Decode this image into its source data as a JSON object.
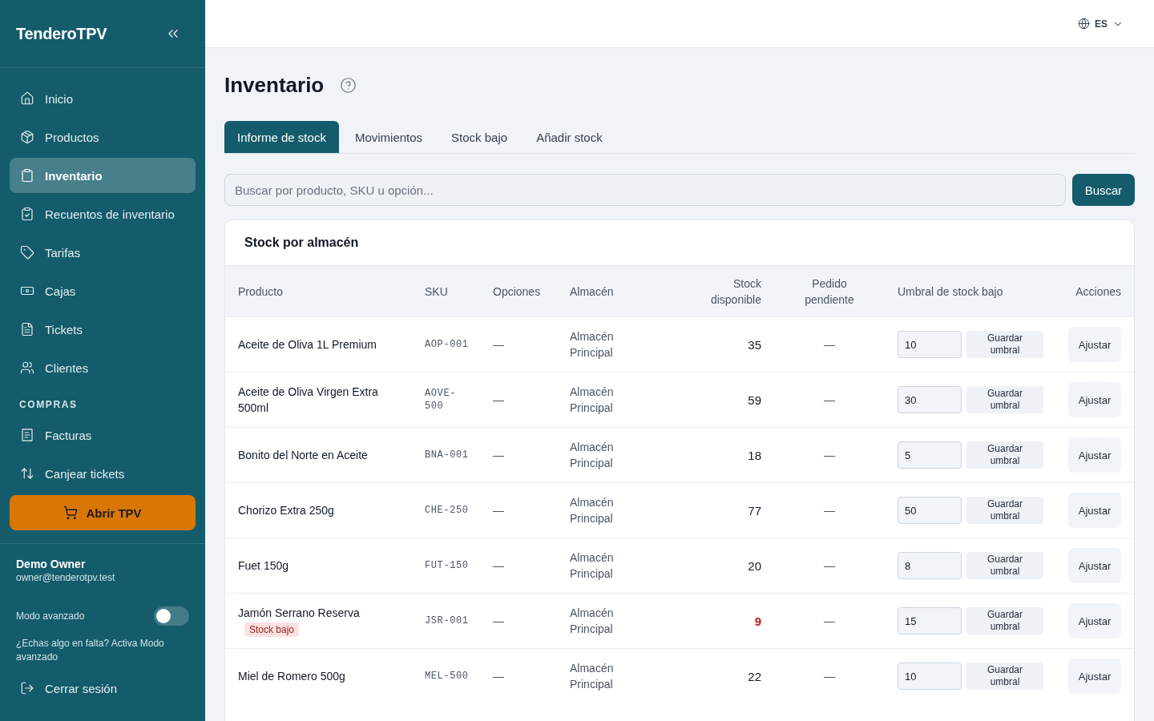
{
  "sidebar": {
    "logo": "TenderoTPV",
    "items": [
      {
        "label": "Inicio",
        "selected": false
      },
      {
        "label": "Productos",
        "selected": false
      },
      {
        "label": "Inventario",
        "selected": true
      },
      {
        "label": "Recuentos de inventario",
        "selected": false
      },
      {
        "label": "Tarifas",
        "selected": false
      },
      {
        "label": "Cajas",
        "selected": false
      },
      {
        "label": "Tickets",
        "selected": false
      },
      {
        "label": "Clientes",
        "selected": false
      }
    ],
    "section": {
      "title": "COMPRAS",
      "items": [
        {
          "label": "Facturas",
          "selected": false
        },
        {
          "label": "Canjear tickets",
          "selected": false
        }
      ]
    },
    "cta": "Abrir TPV",
    "user": {
      "name": "Demo Owner",
      "email": "owner@tenderotpv.test"
    },
    "advanced_mode": {
      "label": "Modo avanzado",
      "on": false
    },
    "hint": "¿Echas algo en falta? Activa Modo avanzado",
    "logout": "Cerrar sesión"
  },
  "header": {
    "language": "ES"
  },
  "page": {
    "title": "Inventario"
  },
  "tabs": [
    {
      "label": "Informe de stock",
      "selected": true
    },
    {
      "label": "Movimientos",
      "selected": false
    },
    {
      "label": "Stock bajo",
      "selected": false
    },
    {
      "label": "Añadir stock",
      "selected": false
    }
  ],
  "search": {
    "placeholder": "Buscar por producto, SKU u opción...",
    "button": "Buscar"
  },
  "stock_card": {
    "title": "Stock por almacén",
    "columns": [
      "Producto",
      "SKU",
      "Opciones",
      "Almacén",
      "Stock disponible",
      "Pedido pendiente",
      "Umbral de stock bajo",
      "Acciones"
    ],
    "rows": [
      {
        "product": "Aceite de Oliva 1L Premium",
        "sku": "AOP-001",
        "options": "—",
        "warehouse": "Almacén Principal",
        "available": "35",
        "low_stock": false,
        "pending": "—",
        "threshold": "10",
        "save_button": "Guardar umbral",
        "action_button": "Ajustar"
      },
      {
        "product": "Aceite de Oliva Virgen Extra 500ml",
        "sku": "AOVE-500",
        "options": "—",
        "warehouse": "Almacén Principal",
        "available": "59",
        "low_stock": false,
        "pending": "—",
        "threshold": "30",
        "save_button": "Guardar umbral",
        "action_button": "Ajustar"
      },
      {
        "product": "Bonito del Norte en Aceite",
        "sku": "BNA-001",
        "options": "—",
        "warehouse": "Almacén Principal",
        "available": "18",
        "low_stock": false,
        "pending": "—",
        "threshold": "5",
        "save_button": "Guardar umbral",
        "action_button": "Ajustar"
      },
      {
        "product": "Chorizo Extra 250g",
        "sku": "CHE-250",
        "options": "—",
        "warehouse": "Almacén Principal",
        "available": "77",
        "low_stock": false,
        "pending": "—",
        "threshold": "50",
        "save_button": "Guardar umbral",
        "action_button": "Ajustar"
      },
      {
        "product": "Fuet 150g",
        "sku": "FUT-150",
        "options": "—",
        "warehouse": "Almacén Principal",
        "available": "20",
        "low_stock": false,
        "pending": "—",
        "threshold": "8",
        "save_button": "Guardar umbral",
        "action_button": "Ajustar"
      },
      {
        "product": "Jamón Serrano Reserva",
        "badge": "Stock bajo",
        "sku": "JSR-001",
        "options": "—",
        "warehouse": "Almacén Principal",
        "available": "9",
        "low_stock": true,
        "pending": "—",
        "threshold": "15",
        "save_button": "Guardar umbral",
        "action_button": "Ajustar"
      },
      {
        "product": "Miel de Romero 500g",
        "sku": "MEL-500",
        "options": "—",
        "warehouse": "Almacén Principal",
        "available": "22",
        "low_stock": false,
        "pending": "—",
        "threshold": "10",
        "save_button": "Guardar umbral",
        "action_button": "Ajustar"
      }
    ]
  }
}
